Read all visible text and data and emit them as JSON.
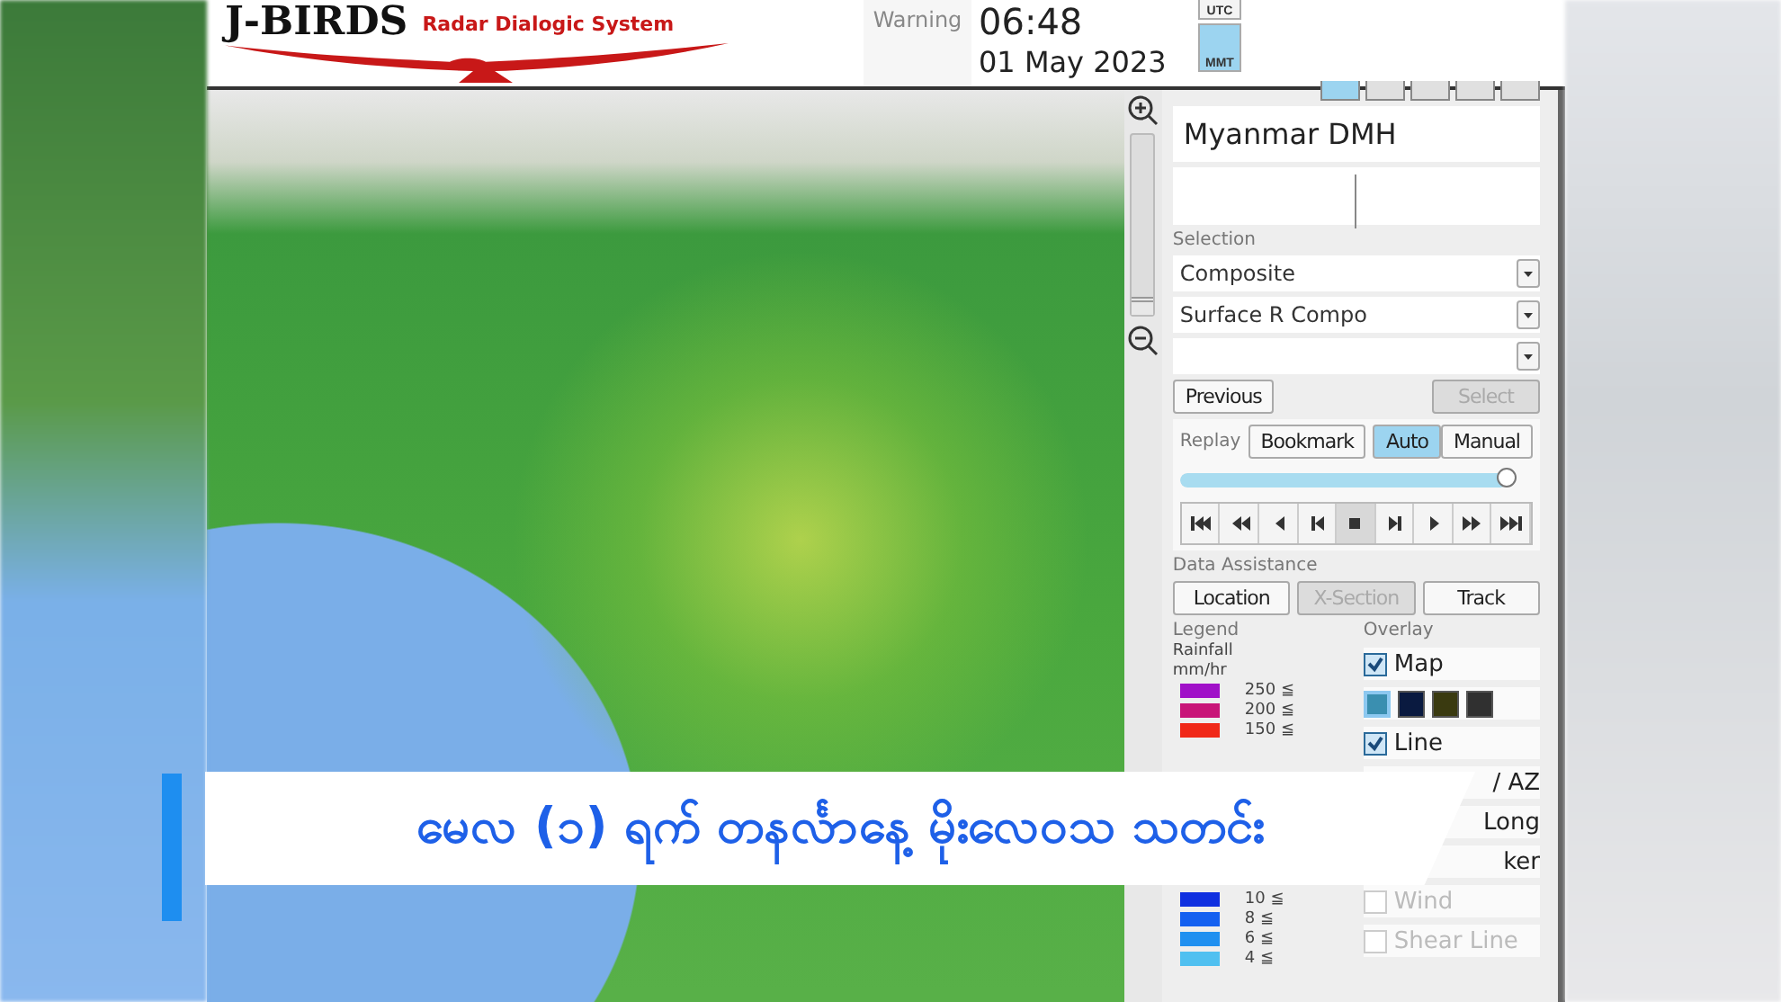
{
  "header": {
    "logo": "J-BIRDS",
    "subtitle": "Radar Dialogic System",
    "warning": "Warning",
    "time": "06:48",
    "date": "01 May 2023",
    "zones": [
      {
        "label": "UTC",
        "selected": false
      },
      {
        "label": "MMT",
        "selected": true
      }
    ]
  },
  "panel": {
    "agency": "Myanmar DMH",
    "selection_label": "Selection",
    "zoom": {
      "level": 0.1
    },
    "selects": [
      {
        "value": "Composite"
      },
      {
        "value": "Surface R Compo"
      }
    ],
    "previous": "Previous",
    "select": {
      "label": "Select",
      "disabled": true
    },
    "replay": {
      "label": "Replay",
      "bookmark": "Bookmark",
      "modes": [
        {
          "label": "Auto",
          "selected": true
        },
        {
          "label": "Manual",
          "selected": false
        }
      ],
      "level": 1,
      "transport": [
        {
          "kind": "first",
          "selected": false
        },
        {
          "kind": "fast-back",
          "selected": false
        },
        {
          "kind": "back",
          "selected": false
        },
        {
          "kind": "step-back",
          "selected": false
        },
        {
          "kind": "stop",
          "selected": true
        },
        {
          "kind": "step-forward",
          "selected": false
        },
        {
          "kind": "play",
          "selected": false
        },
        {
          "kind": "fast-forward",
          "selected": false
        },
        {
          "kind": "last",
          "selected": false
        }
      ]
    },
    "assist_label": "Data Assistance",
    "assist": [
      {
        "label": "Location",
        "disabled": false
      },
      {
        "label": "X-Section",
        "disabled": true
      },
      {
        "label": "Track",
        "disabled": false
      }
    ],
    "legend": {
      "title": "Legend",
      "name": "Rainfall",
      "unit": "mm/hr",
      "top": [
        {
          "label": "250 ≦",
          "color": "#a010c8"
        },
        {
          "label": "200 ≦",
          "color": "#c81478"
        },
        {
          "label": "150 ≦",
          "color": "#f02818"
        }
      ],
      "bottom": [
        {
          "label": "10 ≦",
          "color": "#1030e0"
        },
        {
          "label": "8 ≦",
          "color": "#1460f0"
        },
        {
          "label": "6 ≦",
          "color": "#2090f0"
        },
        {
          "label": "4 ≦",
          "color": "#50c0f0"
        }
      ]
    },
    "overlay": {
      "title": "Overlay",
      "items": [
        {
          "kind": "check",
          "label": "Map",
          "checked": true,
          "disabled": false
        },
        {
          "kind": "swatches",
          "swatches": [
            {
              "color": "#3a8fb0",
              "selected": true
            },
            {
              "color": "#0a1a40",
              "selected": false
            },
            {
              "color": "#3a3a10",
              "selected": false
            },
            {
              "color": "#303030",
              "selected": false
            }
          ]
        },
        {
          "kind": "check",
          "label": "Line",
          "checked": true,
          "disabled": false
        },
        {
          "kind": "text",
          "label": "/ AZ"
        },
        {
          "kind": "text",
          "label": "Long"
        },
        {
          "kind": "text",
          "label": "ker"
        },
        {
          "kind": "check",
          "label": "Wind",
          "checked": false,
          "disabled": true
        },
        {
          "kind": "check",
          "label": "Shear Line",
          "checked": false,
          "disabled": true
        }
      ]
    }
  },
  "banner": {
    "headline": "မေလ (၁) ရက် တနင်္လာနေ့  မိုးလေဝသ သတင်း"
  }
}
